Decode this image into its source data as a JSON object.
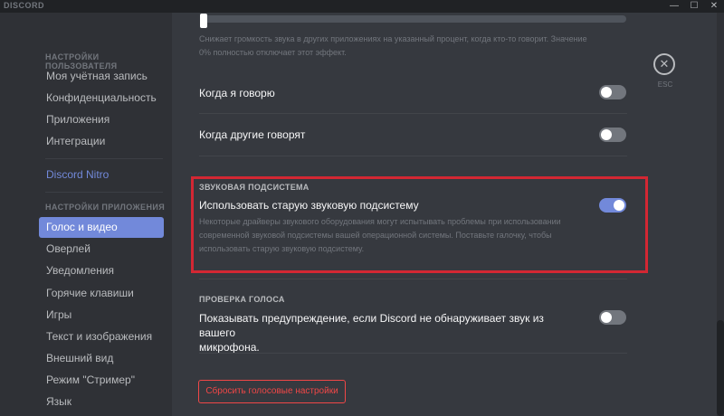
{
  "app": {
    "brand": "DISCORD"
  },
  "window": {
    "minimize": "—",
    "maximize": "☐",
    "close": "✕"
  },
  "sidebar": {
    "user_settings_header": "НАСТРОЙКИ ПОЛЬЗОВАТЕЛЯ",
    "user_items": [
      "Моя учётная запись",
      "Конфиденциальность",
      "Приложения",
      "Интеграции"
    ],
    "nitro": "Discord Nitro",
    "app_settings_header": "НАСТРОЙКИ ПРИЛОЖЕНИЯ",
    "app_items": [
      "Голос и видео",
      "Оверлей",
      "Уведомления",
      "Горячие клавиши",
      "Игры",
      "Текст и изображения",
      "Внешний вид",
      "Режим \"Стример\"",
      "Язык"
    ],
    "active_item": "Голос и видео"
  },
  "content": {
    "attenuation": {
      "description_line1": "Снижает громкость звука в других приложениях на указанный процент, когда кто-то говорит. Значение",
      "description_line2": "0% полностью отключает этот эффект.",
      "slider_value_percent": 0
    },
    "when_i_speak": {
      "label": "Когда я говорю",
      "enabled": false
    },
    "when_others_speak": {
      "label": "Когда другие говорят",
      "enabled": false
    },
    "audio_subsystem": {
      "header": "ЗВУКОВАЯ ПОДСИСТЕМА",
      "label": "Использовать старую звуковую подсистему",
      "enabled": true,
      "description_line1": "Некоторые драйверы звукового оборудования могут испытывать проблемы при использовании",
      "description_line2": "современной звуковой подсистемы вашей операционной системы. Поставьте галочку, чтобы",
      "description_line3": "использовать старую звуковую подсистему."
    },
    "voice_check": {
      "header": "ПРОВЕРКА ГОЛОСА",
      "label_line1": "Показывать предупреждение, если Discord не обнаруживает звук из вашего",
      "label_line2": "микрофона.",
      "enabled": false
    },
    "reset_button": "Сбросить голосовые настройки"
  },
  "close": {
    "icon": "close-icon",
    "glyph": "✕",
    "label": "ESC"
  },
  "colors": {
    "accent": "#7289da",
    "highlight_border": "#d32733",
    "danger": "#f04747"
  }
}
